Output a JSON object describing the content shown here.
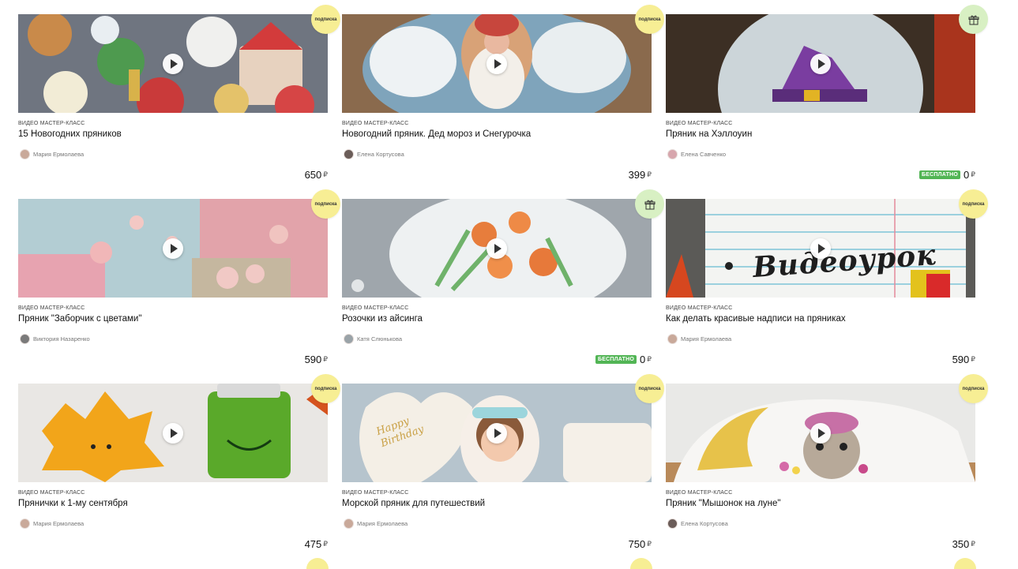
{
  "colors": {
    "subscription_badge": "#f7ee94",
    "gift_badge": "#d8f0c3",
    "free_label": "#52b555"
  },
  "currency_symbol": "₽",
  "cards": [
    {
      "type": "ВИДЕО МАСТЕР-КЛАСС",
      "title": "15 Новогодних пряников",
      "author": "Мария Ермолаева",
      "price": "650",
      "badge": "подписка",
      "badge_kind": "subscription",
      "free_label": "",
      "image": "christmas-cookies-image"
    },
    {
      "type": "ВИДЕО МАСТЕР-КЛАСС",
      "title": "Новогодний пряник. Дед мороз и Снегурочка",
      "author": "Елена Кортусова",
      "price": "399",
      "badge": "подписка",
      "badge_kind": "subscription",
      "free_label": "",
      "image": "santa-cookie-image"
    },
    {
      "type": "ВИДЕО МАСТЕР-КЛАСС",
      "title": "Пряник на Хэллоуин",
      "author": "Елена Савченко",
      "price": "0",
      "badge": "",
      "badge_kind": "gift",
      "free_label": "БЕСПЛАТНО",
      "image": "halloween-cookie-image"
    },
    {
      "type": "ВИДЕО МАСТЕР-КЛАСС",
      "title": "Пряник \"Заборчик с цветами\"",
      "author": "Виктория Назаренко",
      "price": "590",
      "badge": "подписка",
      "badge_kind": "subscription",
      "free_label": "",
      "image": "flower-fence-cookie-image"
    },
    {
      "type": "ВИДЕО МАСТЕР-КЛАСС",
      "title": "Розочки из айсинга",
      "author": "Катя Слюнькова",
      "price": "0",
      "badge": "",
      "badge_kind": "gift",
      "free_label": "БЕСПЛАТНО",
      "image": "icing-roses-image"
    },
    {
      "type": "ВИДЕО МАСТЕР-КЛАСС",
      "title": "Как делать красивые надписи на пряниках",
      "author": "Мария Ермолаева",
      "price": "590",
      "badge": "подписка",
      "badge_kind": "subscription",
      "free_label": "",
      "image": "lettering-cookie-image",
      "image_text": "Видеоурок"
    },
    {
      "type": "ВИДЕО МАСТЕР-КЛАСС",
      "title": "Прянички к 1-му сентября",
      "author": "Мария Ермолаева",
      "price": "475",
      "badge": "подписка",
      "badge_kind": "subscription",
      "free_label": "",
      "image": "september-cookies-image"
    },
    {
      "type": "ВИДЕО МАСТЕР-КЛАСС",
      "title": "Морской пряник для путешествий",
      "author": "Мария Ермолаева",
      "price": "750",
      "badge": "подписка",
      "badge_kind": "subscription",
      "free_label": "",
      "image": "birthday-cookies-image",
      "image_text": "Happy Birthday"
    },
    {
      "type": "ВИДЕО МАСТЕР-КЛАСС",
      "title": "Пряник \"Мышонок на луне\"",
      "author": "Елена Кортусова",
      "price": "350",
      "badge": "подписка",
      "badge_kind": "subscription",
      "free_label": "",
      "image": "mouse-moon-cookie-image"
    }
  ]
}
